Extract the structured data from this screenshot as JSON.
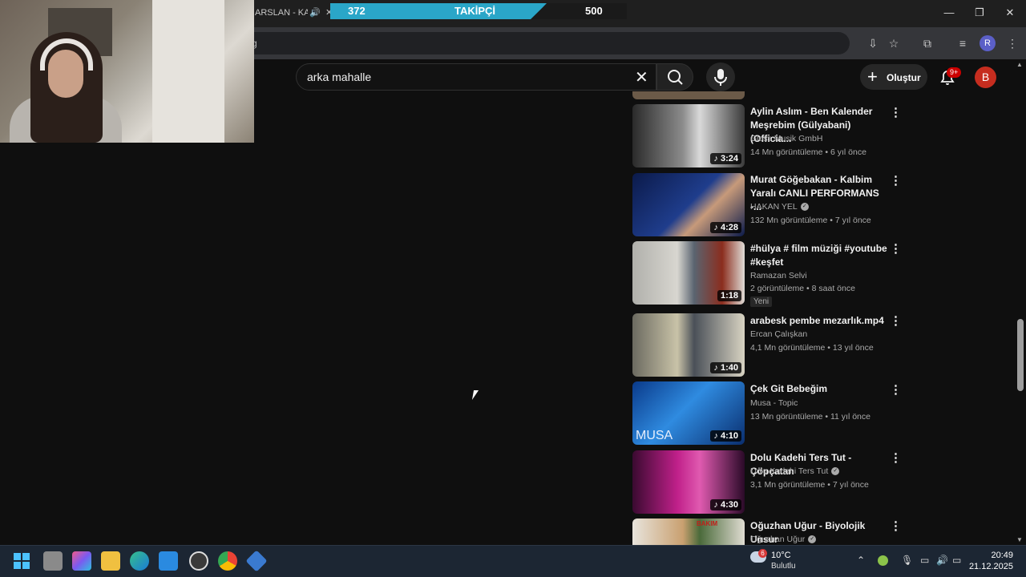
{
  "browser": {
    "tab_title": "ARSLAN - KAR",
    "address_text": "g",
    "profile_initial": "R"
  },
  "follower_goal": {
    "current": "372",
    "label": "TAKİPÇİ",
    "goal": "500",
    "progress_fraction": 0.744
  },
  "youtube": {
    "search_query": "arka mahalle",
    "create_label": "Oluştur",
    "notification_count": "9+",
    "avatar_initial": "B"
  },
  "videos": [
    {
      "title": "Aylin Aslım - Ben Kalender Meşrebim (Gülyabani)  (Officia...",
      "channel": "Gloss Musik GmbH",
      "verified": false,
      "meta": "14 Mn görüntüleme • 6 yıl önce",
      "duration": "3:24",
      "badge": ""
    },
    {
      "title": "Murat Göğebakan - Kalbim Yaralı  CANLI PERFORMANS -...",
      "channel": "HAKAN YEL",
      "verified": true,
      "meta": "132 Mn görüntüleme • 7 yıl önce",
      "duration": "4:28",
      "badge": ""
    },
    {
      "title": "#hülya # film müziği #youtube #keşfet",
      "channel": "Ramazan Selvi",
      "verified": false,
      "meta": "2 görüntüleme • 8 saat önce",
      "duration": "1:18",
      "badge": "Yeni"
    },
    {
      "title": "arabesk pembe mezarlık.mp4",
      "channel": "Ercan Çalışkan",
      "verified": false,
      "meta": "4,1 Mn görüntüleme • 13 yıl önce",
      "duration": "1:40",
      "badge": ""
    },
    {
      "title": "Çek Git Bebeğim",
      "channel": "Musa - Topic",
      "verified": false,
      "meta": "13 Mn görüntüleme • 11 yıl önce",
      "duration": "4:10",
      "badge": ""
    },
    {
      "title": "Dolu Kadehi Ters Tut - Çöpçatan",
      "channel": "Dolu Kadehi Ters Tut",
      "verified": true,
      "meta": "3,1 Mn görüntüleme • 7 yıl önce",
      "duration": "4:30",
      "badge": ""
    },
    {
      "title": "Oğuzhan Uğur - Biyolojik Unsur",
      "channel": "Oğuzhan Uğur",
      "verified": true,
      "meta": "",
      "duration": "",
      "badge": ""
    }
  ],
  "thumb_texts": {
    "musa": "MUSA",
    "bakim": "BAKIM"
  },
  "taskbar": {
    "weather_temp": "10°C",
    "weather_desc": "Bulutlu",
    "weather_badge": "6",
    "time": "20:49",
    "date": "21.12.2025"
  }
}
